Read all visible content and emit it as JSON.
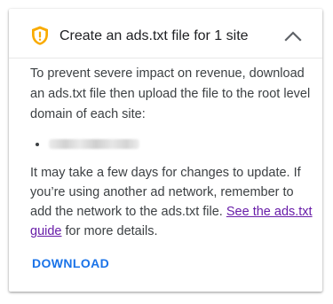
{
  "card": {
    "title": "Create an ads.txt file for 1 site",
    "status_icon": "shield-warning-icon",
    "collapse_icon": "chevron-up-icon",
    "intro_text": "To prevent severe impact on revenue, download an ads.txt file then upload the file to the root level domain of each site:",
    "sites": [
      ""
    ],
    "info_text": "It may take a few days for changes to update. If you’re using another ad network, remember to add the network to the ads.txt file.",
    "guide_link_label": "See the ads.txt guide",
    "info_suffix": "for more details.",
    "download_label": "DOWNLOAD"
  },
  "colors": {
    "warning": "#f9ab00",
    "link": "#681da8",
    "action": "#1a73e8",
    "text": "#3c4043"
  }
}
